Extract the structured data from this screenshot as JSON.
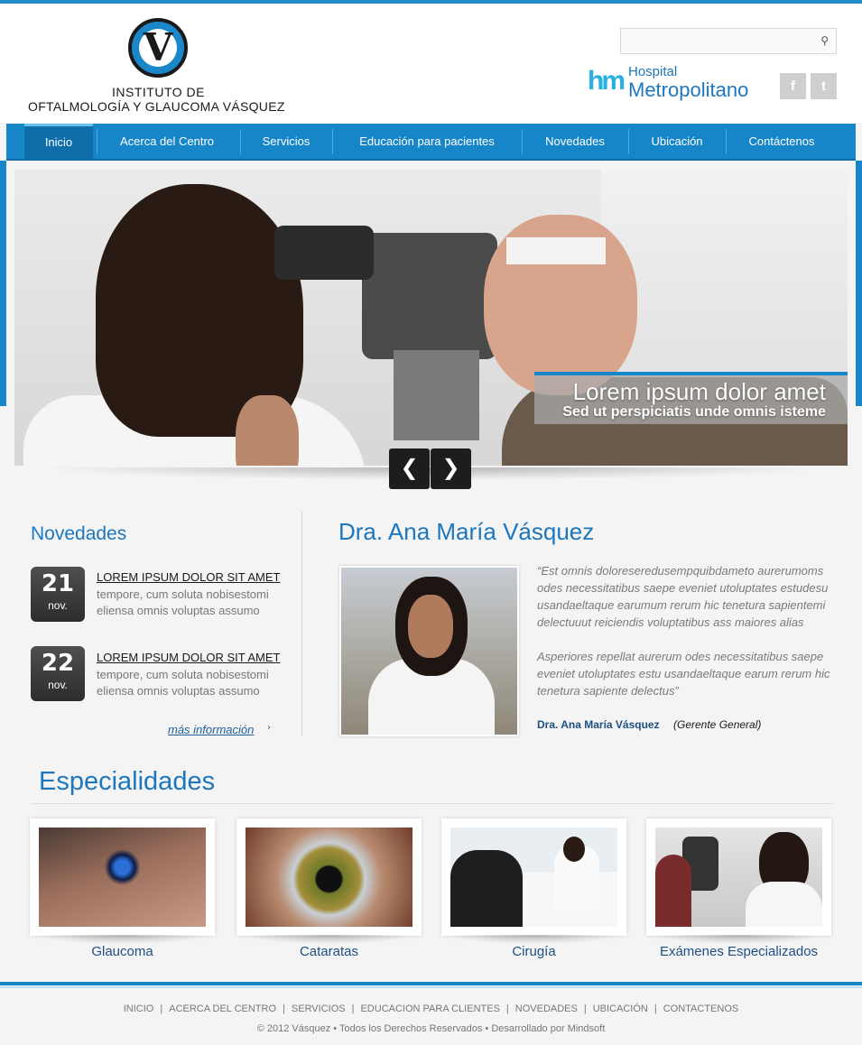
{
  "header": {
    "logo_line1": "INSTITUTO DE",
    "logo_line2": "OFTALMOLOGÍA Y GLAUCOMA VÁSQUEZ",
    "logo_letter": "V",
    "search_placeholder": "",
    "hospital_badge": "hm",
    "hospital_line1": "Hospital",
    "hospital_line2": "Metropolitano",
    "social_facebook": "f",
    "social_twitter": "t"
  },
  "nav": {
    "items": [
      {
        "label": "Inicio",
        "active": true
      },
      {
        "label": "Acerca del Centro"
      },
      {
        "label": "Servicios"
      },
      {
        "label": "Educación para pacientes"
      },
      {
        "label": "Novedades"
      },
      {
        "label": "Ubicación"
      },
      {
        "label": "Contáctenos"
      }
    ]
  },
  "slider": {
    "caption_title": "Lorem ipsum dolor amet",
    "caption_subtitle": "Sed ut perspiciatis unde omnis isteme",
    "prev_glyph": "❮",
    "next_glyph": "❯"
  },
  "novedades": {
    "heading": "Novedades",
    "items": [
      {
        "day": "21",
        "month": "nov.",
        "title": "LOREM IPSUM DOLOR SIT AMET",
        "text": "tempore, cum soluta nobisestomi eliensa omnis voluptas assumo"
      },
      {
        "day": "22",
        "month": "nov.",
        "title": "LOREM IPSUM DOLOR SIT AMET",
        "text": "tempore, cum soluta nobisestomi eliensa omnis voluptas assumo"
      }
    ],
    "more_link": "más información",
    "more_arrow": "›"
  },
  "doctor": {
    "heading": "Dra. Ana María Vásquez",
    "quote_p1": "“Est omnis doloreseredusempquibdameto aurerumoms odes necessitatibus saepe eveniet utoluptates estudesu usandaeltaque earumum rerum hic tenetura sapientemi delectuuut reiciendis voluptatibus ass maiores alias",
    "quote_p2": "Asperiores repellat aurerum odes necessitatibus saepe eveniet utoluptates estu usandaeltaque earum rerum hic tenetura sapiente delectus”",
    "signature_name": "Dra. Ana María Vásquez",
    "signature_role": "(Gerente General)"
  },
  "especialidades": {
    "heading": "Especialidades",
    "cards": [
      {
        "label": "Glaucoma"
      },
      {
        "label": "Cataratas"
      },
      {
        "label": "Cirugía"
      },
      {
        "label": "Exámenes Especializados"
      }
    ]
  },
  "footer": {
    "links": [
      "INICIO",
      "ACERCA DEL CENTRO",
      "SERVICIOS",
      "EDUCACION PARA CLIENTES",
      "NOVEDADES",
      "UBICACIÓN",
      "CONTACTENOS"
    ],
    "separator": "|",
    "copyright": "© 2012 Vásquez • Todos los Derechos Reservados • Desarrollado por Mindsoft"
  },
  "colors": {
    "brand_blue": "#1786c8",
    "nav_active": "#0f6eaa",
    "heading_blue": "#1d77bf",
    "link_navy": "#1d4f86"
  }
}
